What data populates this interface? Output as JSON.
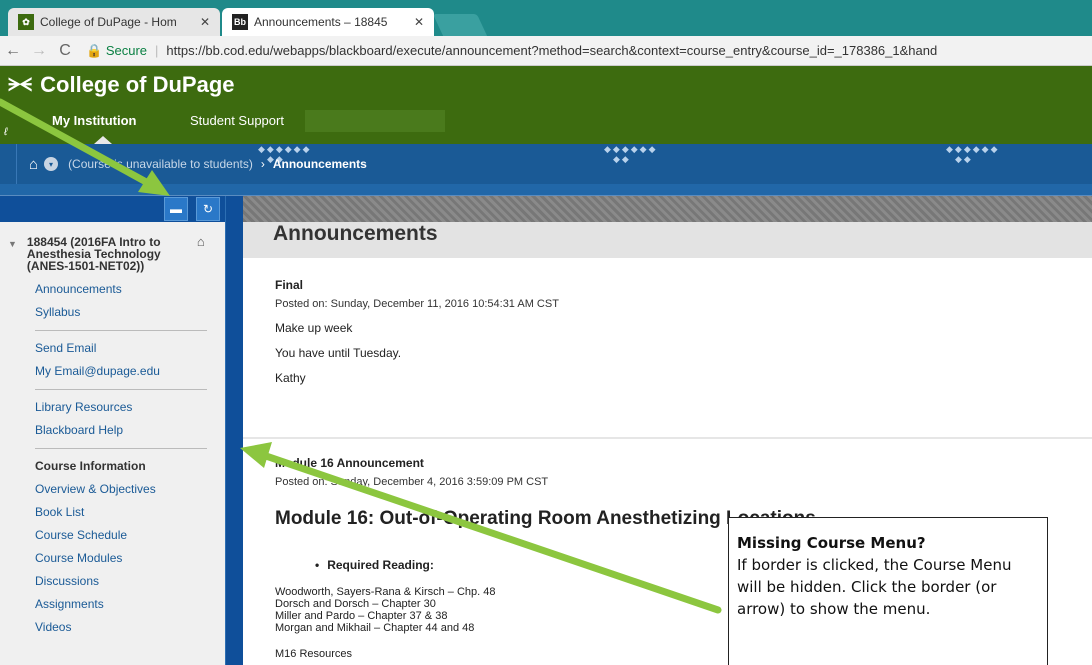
{
  "browser": {
    "tabs": [
      {
        "label": "College of DuPage - Hom",
        "icon": "cod-favicon"
      },
      {
        "label": "Announcements – 18845",
        "icon": "blackboard-favicon"
      }
    ],
    "secure_label": "Secure",
    "url": "https://bb.cod.edu/webapps/blackboard/execute/announcement?method=search&context=course_entry&course_id=_178386_1&hand"
  },
  "header": {
    "logo_text": "College of DuPage",
    "tabs": [
      "My Institution",
      "Student Support"
    ]
  },
  "breadcrumb": {
    "unavailable": "(Course is unavailable to students)",
    "current": "Announcements"
  },
  "sidebar": {
    "course_name": "188454 (2016FA Intro to Anesthesia Technology (ANES-1501-NET02))",
    "group1": [
      "Announcements",
      "Syllabus"
    ],
    "group2": [
      "Send Email",
      "My Email@dupage.edu"
    ],
    "group3": [
      "Library Resources",
      "Blackboard Help"
    ],
    "group4_header": "Course Information",
    "group4": [
      "Overview & Objectives",
      "Book List",
      "Course Schedule",
      "Course Modules",
      "Discussions",
      "Assignments",
      "Videos"
    ]
  },
  "main": {
    "page_title": "Announcements",
    "announcements": [
      {
        "title": "Final",
        "posted": "Posted on: Sunday, December 11, 2016 10:54:31 AM CST",
        "body": [
          "Make up week",
          "You have until Tuesday.",
          "Kathy"
        ]
      },
      {
        "title": "Module 16 Announcement",
        "posted": "Posted on: Sunday, December 4, 2016 3:59:09 PM CST",
        "heading": "Module 16: Out-of-Operating Room Anesthetizing Locations",
        "required": "Required Reading:",
        "readings": [
          "Woodworth, Sayers-Rana & Kirsch – Chp. 48",
          "Dorsch and Dorsch – Chapter 30",
          "Miller and Pardo – Chapter 37 & 38",
          "Morgan and Mikhail – Chapter 44 and 48"
        ],
        "resources": "M16 Resources"
      }
    ]
  },
  "callout": {
    "title": "Missing Course Menu?",
    "text": "If border is clicked, the Course Menu will be hidden. Click the border (or arrow) to show the menu."
  },
  "colors": {
    "header_green": "#3d6b0f",
    "breadcrumb_blue": "#1a5a96",
    "arrow_green": "#8cc63f",
    "link_blue": "#1a5a96"
  }
}
